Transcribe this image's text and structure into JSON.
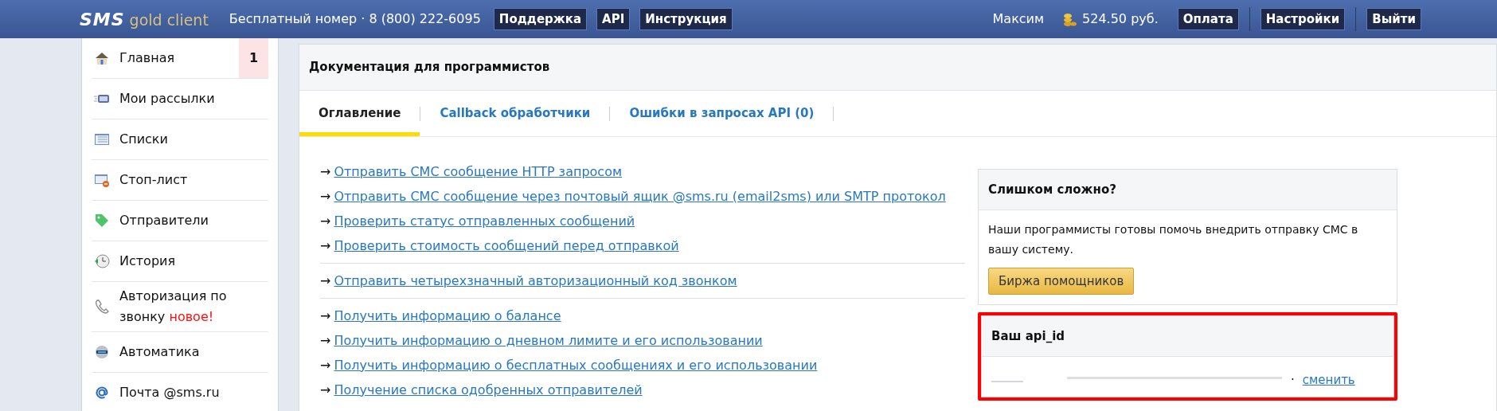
{
  "header": {
    "logo": {
      "mark": "SMS",
      "name": "gold client"
    },
    "phone": "Бесплатный номер · 8 (800) 222-6095",
    "nav_buttons": [
      "Поддержка",
      "API",
      "Инструкция"
    ],
    "user": "Максим",
    "balance": "524.50 руб.",
    "account_buttons": [
      "Оплата",
      "Настройки",
      "Выйти"
    ]
  },
  "sidebar": {
    "items": [
      {
        "label": "Главная",
        "badge": "1"
      },
      {
        "label": "Мои рассылки"
      },
      {
        "label": "Списки"
      },
      {
        "label": "Стоп-лист"
      },
      {
        "label": "Отправители"
      },
      {
        "label": "История"
      },
      {
        "label": "Авторизация по звонку",
        "tag": "новое!"
      },
      {
        "label": "Автоматика"
      },
      {
        "label": "Почта @sms.ru"
      }
    ]
  },
  "panel": {
    "title": "Документация для программистов",
    "tabs": [
      {
        "label": "Оглавление",
        "selected": true
      },
      {
        "label": "Callback обработчики",
        "selected": false
      },
      {
        "label": "Ошибки в запросах API (0)",
        "selected": false
      }
    ],
    "link_groups": [
      [
        {
          "arrow": "→",
          "text": "Отправить СМС сообщение HTTP запросом"
        },
        {
          "arrow": "→",
          "text": "Отправить СМС сообщение через почтовый ящик @sms.ru (email2sms) или SMTP протокол"
        },
        {
          "arrow": "→",
          "text": "Проверить статус отправленных сообщений"
        },
        {
          "arrow": "→",
          "text": "Проверить стоимость сообщений перед отправкой"
        }
      ],
      [
        {
          "arrow": "→",
          "text": "Отправить четырехзначный авторизационный код звонком"
        }
      ],
      [
        {
          "arrow": "→",
          "text": "Получить информацию о балансе"
        },
        {
          "arrow": "→",
          "text": "Получить информацию о дневном лимите и его использовании"
        },
        {
          "arrow": "→",
          "text": "Получить информацию о бесплатных сообщениях и его использовании"
        },
        {
          "arrow": "→",
          "text": "Получение списка одобренных отправителей"
        }
      ]
    ],
    "aside": {
      "help_box": {
        "title": "Слишком сложно?",
        "text": "Наши программисты готовы помочь внедрить отправку СМС в вашу систему.",
        "button": "Биржа помощников"
      },
      "api_box": {
        "title": "Ваш api_id",
        "separator": "·",
        "link": "сменить",
        "highlighted": true
      }
    }
  }
}
